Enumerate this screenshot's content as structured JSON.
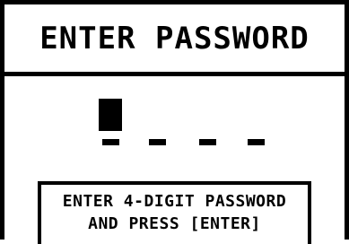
{
  "screen": {
    "title": "ENTER PASSWORD",
    "password": {
      "length": 4,
      "entered_digits": 0,
      "active_slot": 1
    },
    "hint": {
      "line1": "ENTER 4-DIGIT PASSWORD",
      "line2": "AND PRESS [ENTER]"
    }
  },
  "colors": {
    "foreground": "#000000",
    "background": "#ffffff"
  }
}
